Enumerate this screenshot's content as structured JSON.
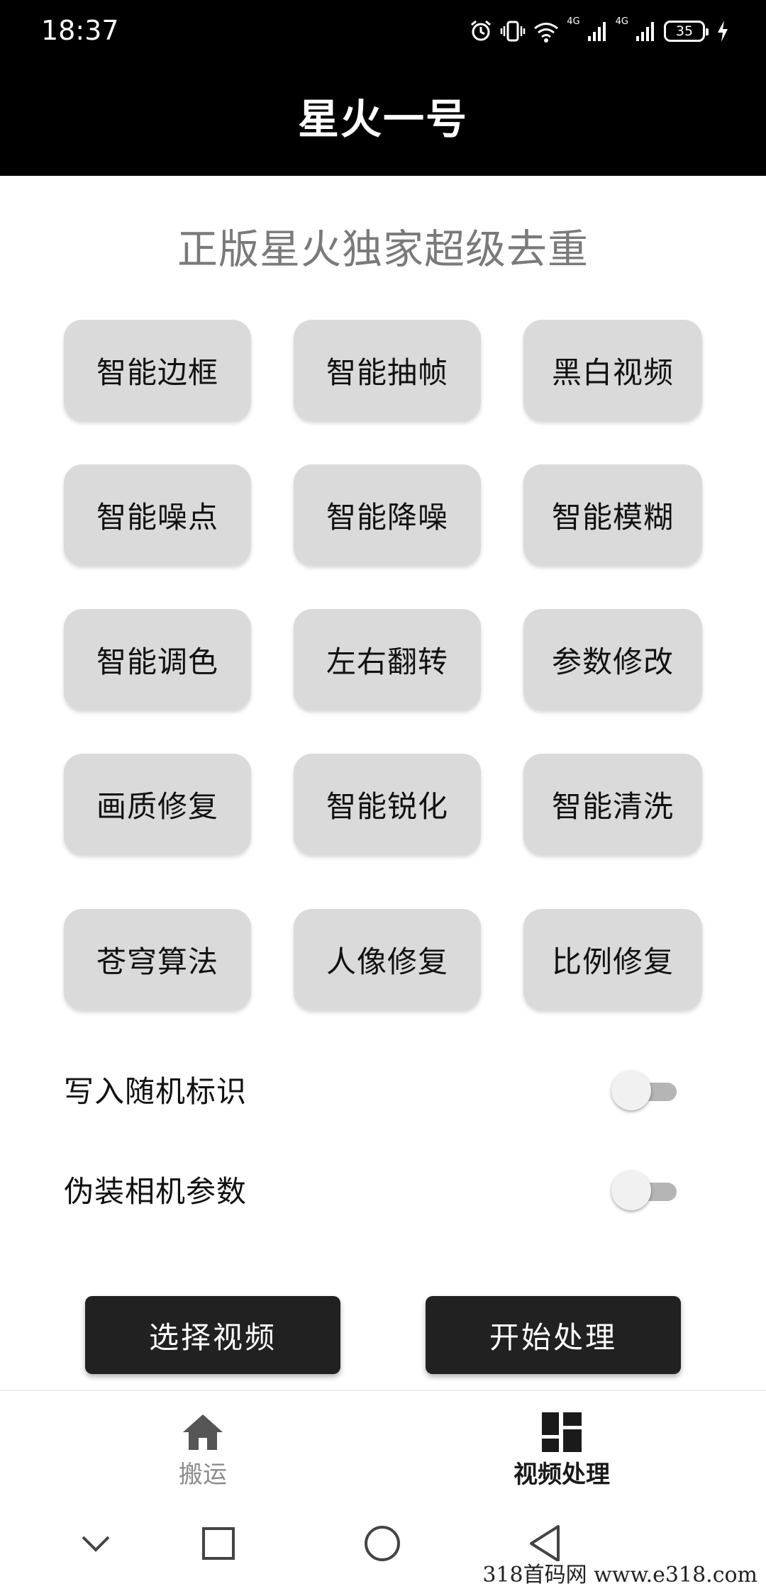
{
  "status_bar": {
    "time": "18:37",
    "network_tag_1": "4G",
    "network_tag_2": "4G",
    "battery_level": "35"
  },
  "app_bar": {
    "title": "星火一号"
  },
  "subtitle": "正版星火独家超级去重",
  "feature_buttons": [
    [
      "智能边框",
      "智能抽帧",
      "黑白视频"
    ],
    [
      "智能噪点",
      "智能降噪",
      "智能模糊"
    ],
    [
      "智能调色",
      "左右翻转",
      "参数修改"
    ],
    [
      "画质修复",
      "智能锐化",
      "智能清洗"
    ],
    [
      "苍穹算法",
      "人像修复",
      "比例修复"
    ]
  ],
  "toggles": [
    {
      "label": "写入随机标识",
      "checked": false
    },
    {
      "label": "伪装相机参数",
      "checked": false
    }
  ],
  "actions": {
    "select_video": "选择视频",
    "start_processing": "开始处理"
  },
  "bottom_nav": {
    "items": [
      {
        "label": "搬运",
        "icon": "home-icon",
        "active": false
      },
      {
        "label": "视频处理",
        "icon": "dashboard-icon",
        "active": true
      }
    ]
  },
  "system_nav": {
    "icons": [
      "chevron-down-icon",
      "square-icon",
      "circle-icon",
      "back-triangle-icon"
    ]
  },
  "watermark": "318首码网 www.e318.com",
  "colors": {
    "app_bar_bg": "#000000",
    "button_bg": "#dadada",
    "action_bg": "#212121",
    "subtitle": "#7a7a7a",
    "toggle_track": "#b5b5b5"
  }
}
